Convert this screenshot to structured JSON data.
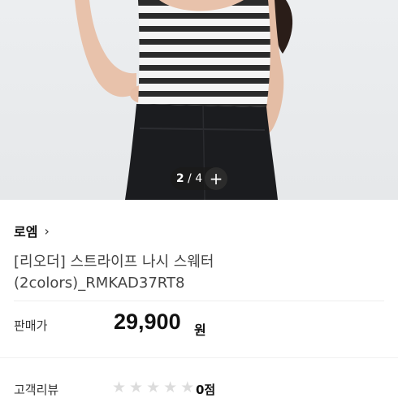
{
  "product": {
    "image_alt": "model wearing striped sleeveless sweater",
    "pager": {
      "current": "2",
      "separator": "/",
      "total": "4",
      "add_label": "+"
    },
    "brand": {
      "name": "로엠",
      "chevron": "›"
    },
    "title_lines": [
      "[리오더] 스트라이프 나시 스웨터",
      "(2colors)_RMKAD37RT8"
    ],
    "price": {
      "label": "판매가",
      "value": "29,900",
      "unit": "원"
    },
    "review": {
      "label": "고객리뷰",
      "rating": 0,
      "max": 5,
      "score_text": "0점"
    }
  },
  "colors": {
    "stripe_dark": "#2b2b2b",
    "stripe_light": "#f4f4f4",
    "skirt": "#1b1c1f",
    "skin": "#e8c2ab",
    "hair": "#2a1d18",
    "background": "#e9ebed"
  }
}
